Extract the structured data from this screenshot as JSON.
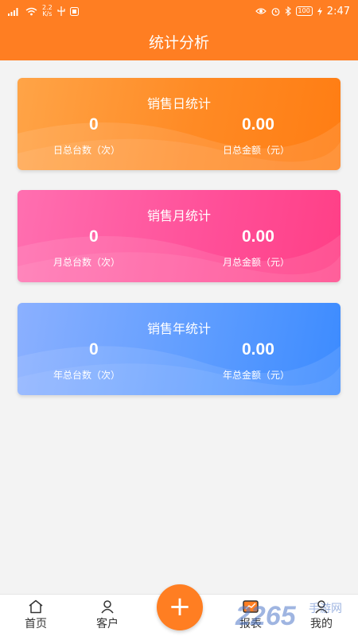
{
  "status_bar": {
    "speed_value": "2.2",
    "speed_unit": "K/s",
    "battery": "100",
    "time": "2:47"
  },
  "app_bar": {
    "title": "统计分析"
  },
  "cards": {
    "day": {
      "title": "销售日统计",
      "count_value": "0",
      "count_label": "日总台数（次）",
      "amount_value": "0.00",
      "amount_label": "日总金额（元）",
      "color": "#ff8a24"
    },
    "month": {
      "title": "销售月统计",
      "count_value": "0",
      "count_label": "月总台数（次）",
      "amount_value": "0.00",
      "amount_label": "月总金额（元）",
      "color": "#ff4f98"
    },
    "year": {
      "title": "销售年统计",
      "count_value": "0",
      "count_label": "年总台数（次）",
      "amount_value": "0.00",
      "amount_label": "年总金额（元）",
      "color": "#5f9dff"
    }
  },
  "tab_bar": {
    "home": {
      "label": "首页",
      "icon": "home-icon"
    },
    "customer": {
      "label": "客户",
      "icon": "person-icon"
    },
    "add": {
      "label": "+",
      "icon": "plus-icon"
    },
    "report": {
      "label": "报表",
      "icon": "report-icon"
    },
    "mine": {
      "label": "我的",
      "icon": "user-icon"
    }
  },
  "watermark": {
    "number": "2265",
    "site": "手游网"
  },
  "accent_color": "#ff7e22"
}
